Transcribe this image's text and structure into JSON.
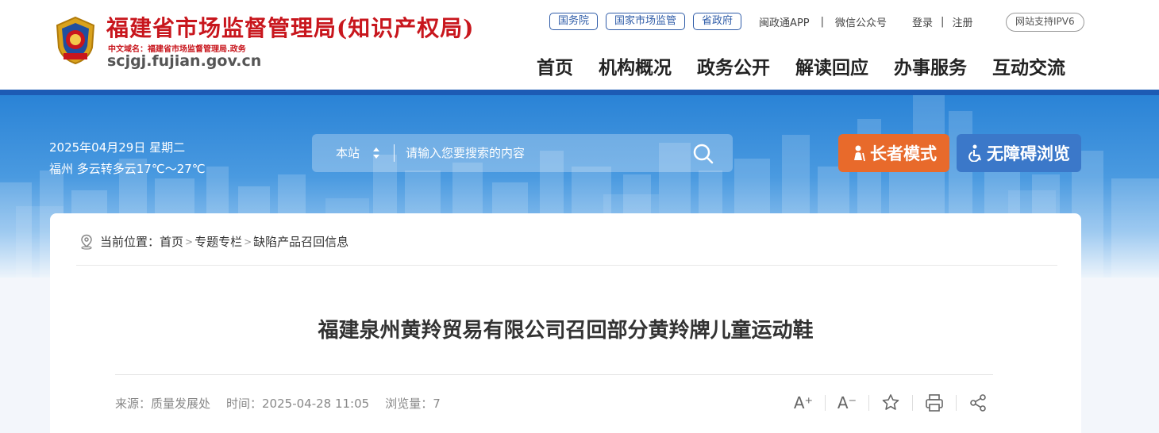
{
  "header": {
    "site_title": "福建省市场监督管理局(知识产权局)",
    "domain_cn": "中文域名：福建省市场监督管理局.政务",
    "domain": "scjgj.fujian.gov.cn",
    "top_links": {
      "gov_council": "国务院",
      "samr": "国家市场监管",
      "province_gov": "省政府",
      "mzt_app": "闽政通APP",
      "wechat": "微信公众号",
      "login": "登录",
      "register": "注册",
      "ipv6": "网站支持IPV6"
    },
    "nav": [
      "首页",
      "机构概况",
      "政务公开",
      "解读回应",
      "办事服务",
      "互动交流"
    ]
  },
  "banner": {
    "date": "2025年04月29日 星期二",
    "weather": "福州 多云转多云17℃～27℃",
    "search_scope": "本站",
    "search_placeholder": "请输入您要搜索的内容",
    "elder_mode": "长者模式",
    "accessible": "无障碍浏览"
  },
  "breadcrumb": {
    "label": "当前位置：",
    "items": [
      "首页",
      "专题专栏",
      "缺陷产品召回信息"
    ],
    "separator": ">"
  },
  "article": {
    "title": "福建泉州黄羚贸易有限公司召回部分黄羚牌儿童运动鞋",
    "source": "来源：质量发展处",
    "time": "时间：2025-04-28 11:05",
    "views": "浏览量：7"
  },
  "tools": {
    "font_increase": "A⁺",
    "font_decrease": "A⁻"
  },
  "colors": {
    "brand_red": "#c8161d",
    "brand_blue": "#1d5bb4",
    "elder_orange": "#e86a2b",
    "access_blue": "#3b78c9"
  }
}
